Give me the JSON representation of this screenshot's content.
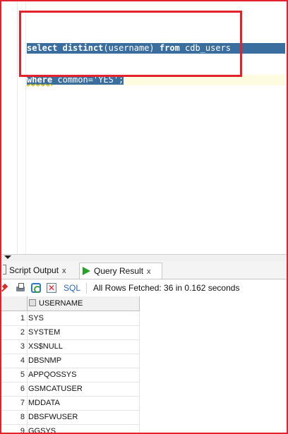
{
  "editor": {
    "line1": {
      "kw1": "select",
      "kw2": "distinct",
      "mid": "(username) ",
      "kw3": "from",
      "tail": " cdb_users"
    },
    "line2": {
      "kw": "where",
      "tail": " common='YES';"
    }
  },
  "tabs": [
    {
      "label": "Script Output",
      "close": "x"
    },
    {
      "label": "Query Result",
      "close": "x"
    }
  ],
  "toolbar": {
    "sql_label": "SQL",
    "status": "All Rows Fetched: 36 in 0.162 seconds"
  },
  "grid": {
    "column": "USERNAME",
    "rows": [
      {
        "n": "1",
        "v": "SYS"
      },
      {
        "n": "2",
        "v": "SYSTEM"
      },
      {
        "n": "3",
        "v": "XS$NULL"
      },
      {
        "n": "4",
        "v": "DBSNMP"
      },
      {
        "n": "5",
        "v": "APPQOSSYS"
      },
      {
        "n": "6",
        "v": "GSMCATUSER"
      },
      {
        "n": "7",
        "v": "MDDATA"
      },
      {
        "n": "8",
        "v": "DBSFWUSER"
      },
      {
        "n": "9",
        "v": "GGSYS"
      }
    ]
  },
  "colors": {
    "highlight": "#e3222b",
    "selection": "#3a6e9e",
    "run_icon": "#27a127"
  },
  "icons": [
    "pin-icon",
    "print-icon",
    "refresh-icon",
    "cancel-icon",
    "run-icon",
    "collapse-arrow-icon"
  ]
}
